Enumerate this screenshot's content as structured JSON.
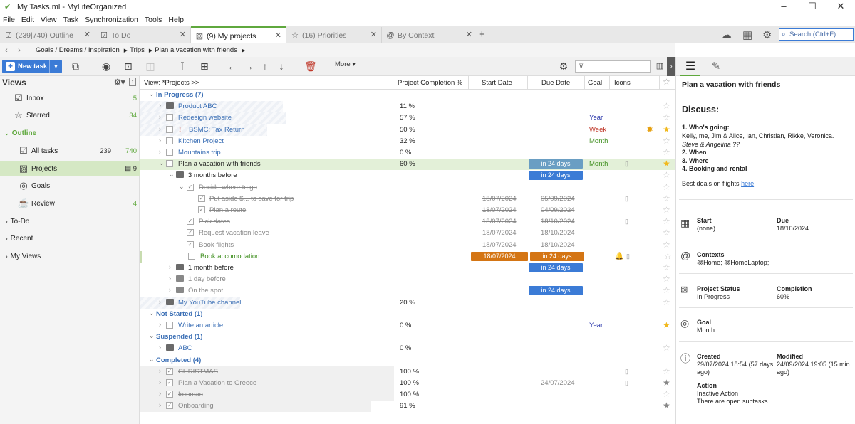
{
  "window": {
    "title": "My Tasks.ml - MyLifeOrganized",
    "controls": [
      "–",
      "☐",
      "✕"
    ]
  },
  "menu": [
    "File",
    "Edit",
    "View",
    "Task",
    "Synchronization",
    "Tools",
    "Help"
  ],
  "tabs": [
    {
      "label": "(239|740) Outline"
    },
    {
      "label": "To Do"
    },
    {
      "label": "(9) My projects"
    },
    {
      "label": "(16) Priorities"
    },
    {
      "label": "By Context"
    }
  ],
  "search": {
    "placeholder": "Search (Ctrl+F)"
  },
  "breadcrumb": [
    "Goals / Dreams / Inspiration",
    "Trips",
    "Plan a vacation with friends"
  ],
  "toolbar": {
    "new_task": "New task",
    "more": "More"
  },
  "sidebar": {
    "title": "Views",
    "items": [
      {
        "label": "Inbox",
        "count": "5"
      },
      {
        "label": "Starred",
        "count": "34"
      },
      {
        "label": "Outline"
      },
      {
        "label": "All tasks",
        "count_a": "239",
        "count_b": "740"
      },
      {
        "label": "Projects",
        "count": "9"
      },
      {
        "label": "Goals"
      },
      {
        "label": "Review",
        "count": "4"
      },
      {
        "label": "To-Do"
      },
      {
        "label": "Recent"
      },
      {
        "label": "My Views"
      }
    ]
  },
  "columns": {
    "view": "View: *Projects >>",
    "completion": "Project Completion %",
    "start": "Start Date",
    "due": "Due Date",
    "goal": "Goal",
    "icons": "Icons"
  },
  "rows": [
    {
      "text": "In Progress   (7)"
    },
    {
      "text": "Product ABC",
      "pct": "11 %"
    },
    {
      "text": "Redesign website",
      "pct": "57 %",
      "goal": "Year"
    },
    {
      "text": "BSMC: Tax Return",
      "pct": "50 %",
      "goal": "Week"
    },
    {
      "text": "Kitchen Project",
      "pct": "32 %",
      "goal": "Month"
    },
    {
      "text": "Mountains trip",
      "pct": "0 %"
    },
    {
      "text": "Plan a vacation with friends",
      "pct": "60 %",
      "due": "in 24 days",
      "goal": "Month"
    },
    {
      "text": "3 months before",
      "due": "in 24 days"
    },
    {
      "text": "Decide where to go"
    },
    {
      "text": "Put aside $... to save for trip",
      "start": "18/07/2024",
      "due": "05/09/2024"
    },
    {
      "text": "Plan a route",
      "start": "18/07/2024",
      "due": "04/09/2024"
    },
    {
      "text": "Pick dates",
      "start": "18/07/2024",
      "due": "18/10/2024"
    },
    {
      "text": "Request vacation leave",
      "start": "18/07/2024",
      "due": "18/10/2024"
    },
    {
      "text": "Book flights",
      "start": "18/07/2024",
      "due": "18/10/2024"
    },
    {
      "text": "Book accomodation",
      "start": "18/07/2024",
      "due": "in 24 days"
    },
    {
      "text": "1 month before",
      "due": "in 24 days"
    },
    {
      "text": "1 day before"
    },
    {
      "text": "On the spot",
      "due": "in 24 days"
    },
    {
      "text": "My YouTube channel",
      "pct": "20 %"
    },
    {
      "text": "Not Started   (1)"
    },
    {
      "text": "Write an article",
      "pct": "0 %",
      "goal": "Year"
    },
    {
      "text": "Suspended   (1)"
    },
    {
      "text": "ABC",
      "pct": "0 %"
    },
    {
      "text": "Completed   (4)"
    },
    {
      "text": "CHRISTMAS",
      "pct": "100 %"
    },
    {
      "text": "Plan a Vacation to Greece",
      "pct": "100 %",
      "due": "24/07/2024"
    },
    {
      "text": "Ironman",
      "pct": "100 %"
    },
    {
      "text": "Onboarding",
      "pct": "91 %"
    }
  ],
  "colors": {
    "accent": "#5fa83d",
    "blue": "#3b7bd6",
    "steel": "#6a9ec3",
    "orange": "#d47514",
    "star": "#f1b91f"
  },
  "details": {
    "title": "Plan a vacation with friends",
    "discuss": "Discuss:",
    "notes": [
      "1. Who's going:",
      "Kelly, me, Jim & Alice, Ian, Christian, Rikke, Veronica.",
      "Steve & Angelina ??",
      "2. When",
      "3. Where",
      "4. Booking and rental"
    ],
    "deals": "Best deals on flights",
    "deals_link": "here",
    "start_label": "Start",
    "start_value": "(none)",
    "due_label": "Due",
    "due_value": "18/10/2024",
    "contexts_label": "Contexts",
    "contexts_value": "@Home; @HomeLaptop;",
    "status_label": "Project Status",
    "status_value": "In Progress",
    "completion_label": "Completion",
    "completion_value": "60%",
    "goal_label": "Goal",
    "goal_value": "Month",
    "created_label": "Created",
    "created_value": "29/07/2024 18:54 (57 days ago)",
    "modified_label": "Modified",
    "modified_value": "24/09/2024 19:05 (15 min ago)",
    "action_label": "Action",
    "action_value_1": "Inactive Action",
    "action_value_2": "There are open subtasks"
  }
}
